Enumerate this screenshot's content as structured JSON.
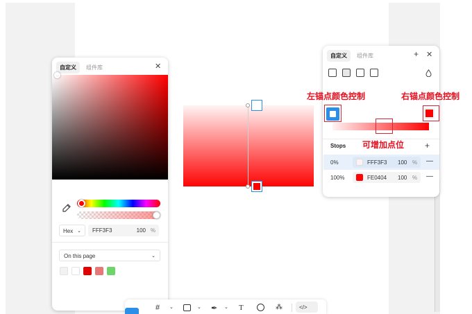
{
  "left_picker": {
    "tab_custom": "自定义",
    "tab_library": "组件库",
    "close": "✕",
    "mode": "Hex",
    "hex_value": "FFF3F3",
    "alpha": "100",
    "alpha_unit": "%",
    "page_select": "On this page",
    "swatch_colors": [
      "#f2f2f2",
      "#ffffff",
      "#e00000",
      "#e87878",
      "#6fd46a"
    ]
  },
  "right_panel": {
    "tab_custom": "自定义",
    "tab_library": "组件库",
    "plus": "+",
    "close": "✕",
    "stops_label": "Stops",
    "add_stop": "+",
    "stops": [
      {
        "position": "0%",
        "hex": "FFF3F3",
        "alpha": "100",
        "unit": "%",
        "color": "#fff3f3",
        "remove": "—"
      },
      {
        "position": "100%",
        "hex": "FE0404",
        "alpha": "100",
        "unit": "%",
        "color": "#fe0404",
        "remove": "—"
      }
    ]
  },
  "annotations": {
    "left_anchor": "左锚点颜色控制",
    "right_anchor": "右锚点颜色控制",
    "add_point": "可增加点位"
  },
  "toolbar": {
    "text_tool": "T",
    "code_label": "</>"
  },
  "colors": {
    "accent": "#2b8fe8",
    "annotation": "#e8101f",
    "gradient_start": "#fff3f3",
    "gradient_end": "#fe0404"
  }
}
